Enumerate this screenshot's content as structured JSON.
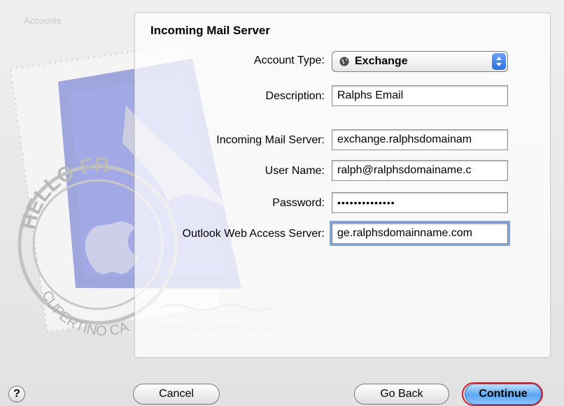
{
  "window": {
    "faded_title": "Accounts"
  },
  "panel": {
    "title": "Incoming Mail Server"
  },
  "form": {
    "account_type": {
      "label": "Account Type:",
      "value": "Exchange"
    },
    "description": {
      "label": "Description:",
      "value": "Ralphs Email"
    },
    "incoming_mail_server": {
      "label": "Incoming Mail Server:",
      "value": "exchange.ralphsdomainam"
    },
    "user_name": {
      "label": "User Name:",
      "value": "ralph@ralphsdomainame.c"
    },
    "password": {
      "label": "Password:",
      "value": "••••••••••••••"
    },
    "owa_server": {
      "label": "Outlook Web Access Server:",
      "value": "ge.ralphsdomainname.com"
    }
  },
  "buttons": {
    "help": "?",
    "cancel": "Cancel",
    "go_back": "Go Back",
    "continue": "Continue"
  },
  "artwork": {
    "postmark_text": "CUPERTINO CA",
    "stamp_text": "HELLO FR"
  },
  "colors": {
    "highlight": "#d4202a",
    "focus_ring": "#7fa6d9",
    "primary_button": "#5aa6f4"
  }
}
